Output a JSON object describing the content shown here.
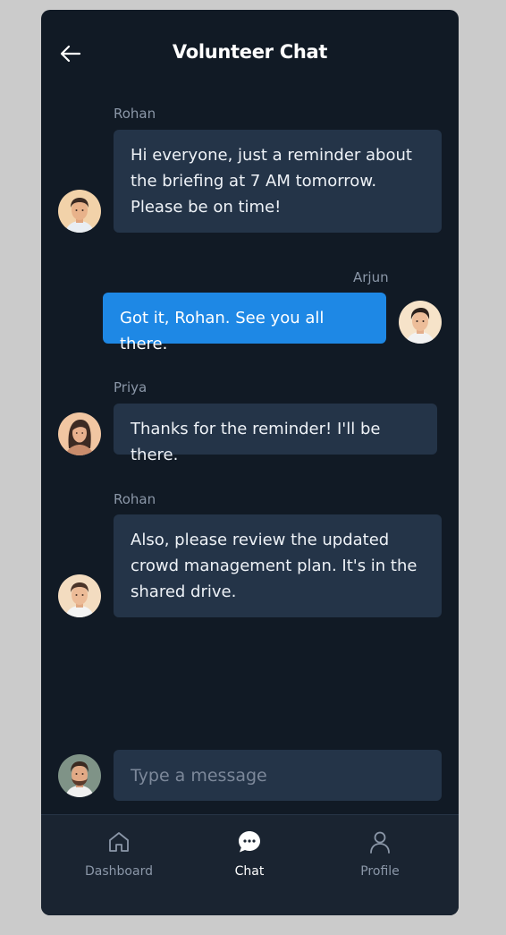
{
  "header": {
    "title": "Volunteer Chat",
    "back_icon": "arrow-left-icon"
  },
  "messages": [
    {
      "sender": "Rohan",
      "text": "Hi everyone, just a reminder about the briefing at 7 AM tomorrow. Please be on time!",
      "mine": false
    },
    {
      "sender": "Arjun",
      "text": "Got it, Rohan. See you all there.",
      "mine": true
    },
    {
      "sender": "Priya",
      "text": "Thanks for the reminder! I'll be there.",
      "mine": false
    },
    {
      "sender": "Rohan",
      "text": "Also, please review the updated crowd management plan. It's in the shared drive.",
      "mine": false
    }
  ],
  "composer": {
    "placeholder": "Type a message"
  },
  "nav": {
    "items": [
      {
        "label": "Dashboard",
        "icon": "home-icon",
        "active": false
      },
      {
        "label": "Chat",
        "icon": "chat-bubble-icon",
        "active": true
      },
      {
        "label": "Profile",
        "icon": "user-icon",
        "active": false
      }
    ]
  },
  "colors": {
    "background": "#111a25",
    "bubble": "#243448",
    "bubble_mine": "#1e88e5",
    "nav_background": "#1a2431",
    "muted_text": "#8b97a8"
  }
}
